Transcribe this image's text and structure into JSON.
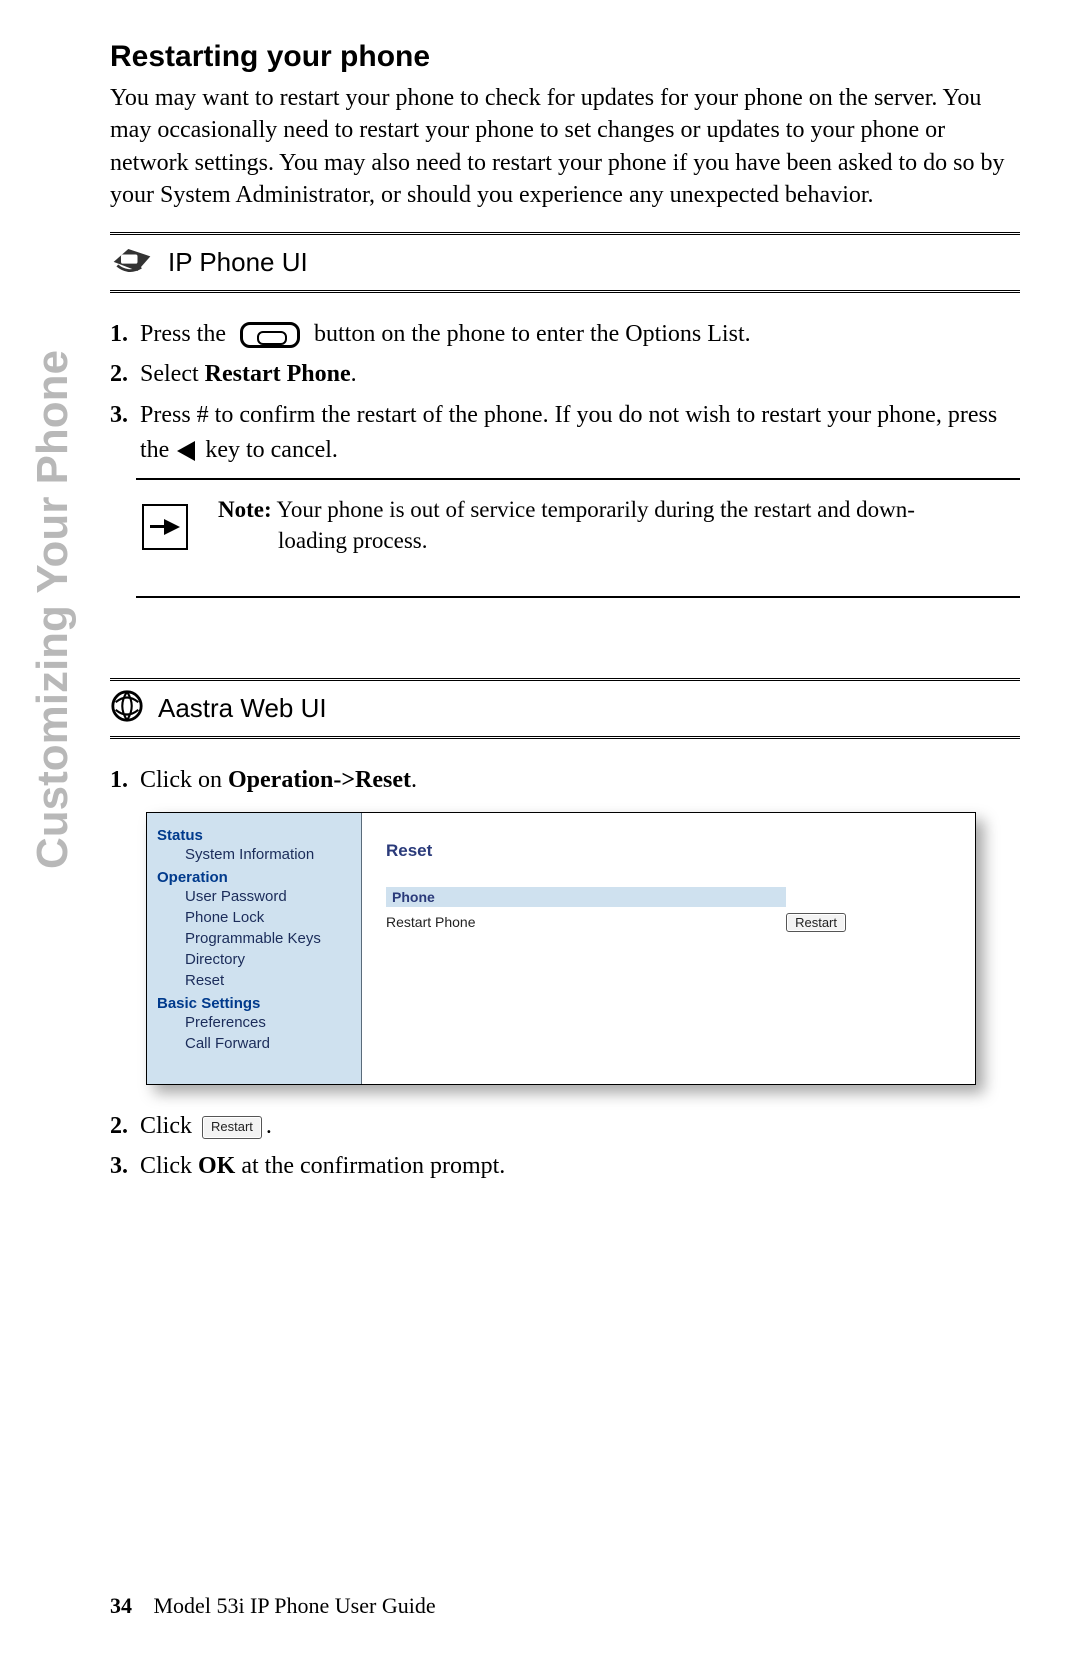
{
  "side_tab": "Customizing Your Phone",
  "heading": "Restarting your phone",
  "intro": "You may want to restart your phone to check for updates for your phone on the server. You may occasionally need to restart your phone to set changes or updates to your phone or network settings.  You may also need to restart your phone if you have been asked to do so by your System Administrator, or should you experience any unexpected behavior.",
  "ip_phone_ui_title": "IP Phone UI",
  "steps_a": {
    "s1_pre": "Press the",
    "s1_post": "button on the phone to enter the Options List.",
    "s2_pre": "Select ",
    "s2_bold": "Restart Phone",
    "s2_post": ".",
    "s3_pre": "Press # to confirm the restart of the phone. If you do not wish to restart your phone, press the",
    "s3_post": "key to cancel."
  },
  "note": {
    "label": "Note:",
    "line1": " Your phone is out of service temporarily during the restart and down-",
    "line2": "loading process."
  },
  "aastra_web_ui_title": "Aastra Web UI",
  "steps_b": {
    "s1_pre": "Click on ",
    "s1_bold": "Operation->Reset",
    "s1_post": ".",
    "s2_pre": "Click",
    "s2_post": ".",
    "s3_pre": "Click ",
    "s3_bold": "OK",
    "s3_post": " at the confirmation prompt."
  },
  "webui": {
    "side": {
      "cat1": "Status",
      "i1": "System Information",
      "cat2": "Operation",
      "i2": "User Password",
      "i3": "Phone Lock",
      "i4": "Programmable Keys",
      "i5": "Directory",
      "i6": "Reset",
      "cat3": "Basic Settings",
      "i7": "Preferences",
      "i8": "Call Forward"
    },
    "main": {
      "header": "Reset",
      "section": "Phone",
      "row_label": "Restart Phone",
      "row_button": "Restart"
    }
  },
  "inline_restart_btn": "Restart",
  "footer": {
    "page": "34",
    "title": "Model 53i IP Phone User Guide"
  }
}
